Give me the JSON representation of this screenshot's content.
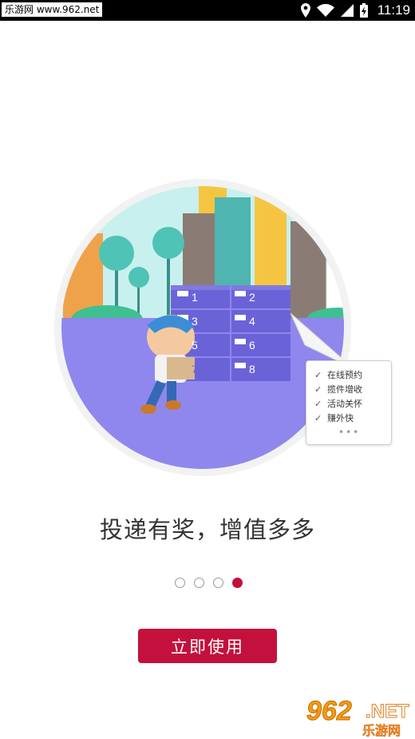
{
  "status_bar": {
    "watermark": "乐游网 www.962.net",
    "time": "11:19",
    "icons": [
      "location-icon",
      "wifi-icon",
      "signal-icon",
      "battery-charging-icon"
    ]
  },
  "illustration": {
    "locker_numbers": [
      "1",
      "2",
      "3",
      "4",
      "5",
      "6",
      "7",
      "8"
    ],
    "checklist": {
      "items": [
        "在线预约",
        "揽件增收",
        "活动关怀",
        "赚外快"
      ],
      "more": "•••"
    }
  },
  "headline": "投递有奖，增值多多",
  "pager": {
    "count": 4,
    "active_index": 3
  },
  "start_button": {
    "label": "立即使用"
  },
  "logo": {
    "number": "962",
    "suffix": ".NET",
    "name": "乐游网"
  },
  "colors": {
    "accent": "#c4103c",
    "ground": "#8f87ee",
    "sky": "#c8f0ee",
    "locker": "#6a63d8"
  }
}
